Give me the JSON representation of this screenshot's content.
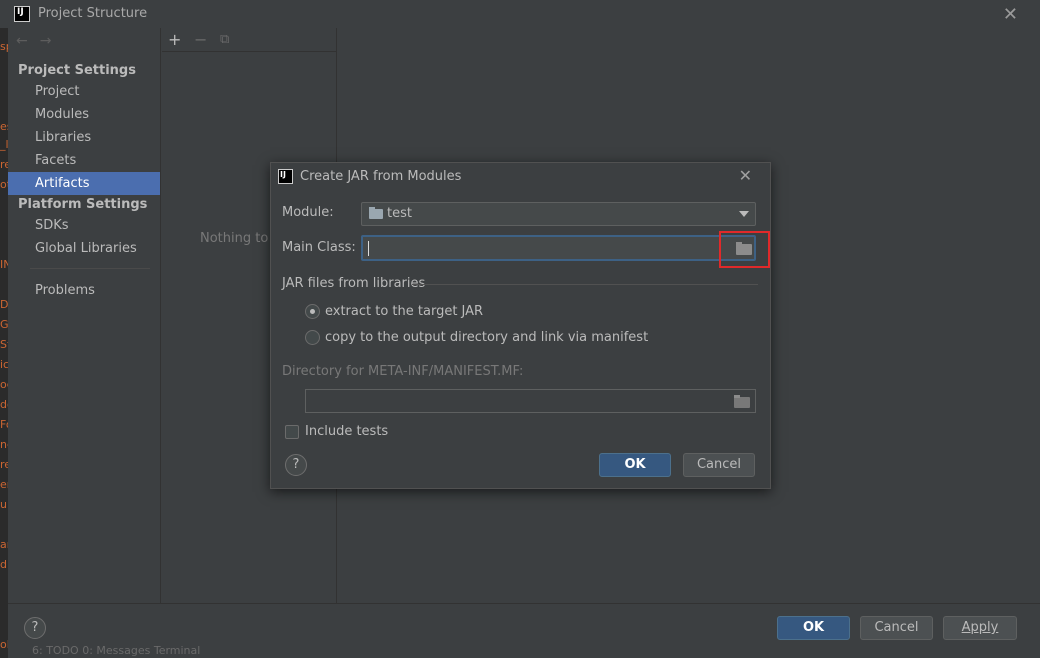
{
  "window": {
    "title": "Project Structure"
  },
  "ide_strip": {
    "fragments": [
      "sp",
      "es",
      "_l",
      "re",
      "ot",
      "IN",
      "Da",
      "Ga",
      "St",
      "ic",
      "oc",
      "do",
      "Fo",
      "ne",
      "re",
      "eri",
      "up",
      "ar",
      "d",
      "ol"
    ]
  },
  "sidebar": {
    "sections": {
      "project_settings": "Project Settings",
      "platform_settings": "Platform Settings"
    },
    "items": [
      {
        "label": "Project"
      },
      {
        "label": "Modules"
      },
      {
        "label": "Libraries"
      },
      {
        "label": "Facets"
      },
      {
        "label": "Artifacts",
        "active": true
      },
      {
        "label": "SDKs"
      },
      {
        "label": "Global Libraries"
      },
      {
        "label": "Problems"
      }
    ]
  },
  "middle": {
    "empty_text": "Nothing to s"
  },
  "bottom": {
    "help": "?",
    "ok": "OK",
    "cancel": "Cancel",
    "apply": "Apply",
    "ghost_tabs": "6: TODO     0: Messages     Terminal"
  },
  "dialog": {
    "title": "Create JAR from Modules",
    "module_label": "Module:",
    "module_value": "test",
    "main_class_label": "Main Class:",
    "main_class_value": "",
    "jar_group_label": "JAR files from libraries",
    "radio_extract": "extract to the target JAR",
    "radio_copy": "copy to the output directory and link via manifest",
    "selected_option": "extract",
    "manifest_label": "Directory for META-INF/MANIFEST.MF:",
    "manifest_value": "",
    "include_tests": "Include tests",
    "include_tests_checked": false,
    "help": "?",
    "ok": "OK",
    "cancel": "Cancel"
  },
  "colors": {
    "accent_selection": "#4b6eaf",
    "primary_button": "#365880",
    "highlight_box": "#e0292a",
    "background": "#3c3f41"
  }
}
